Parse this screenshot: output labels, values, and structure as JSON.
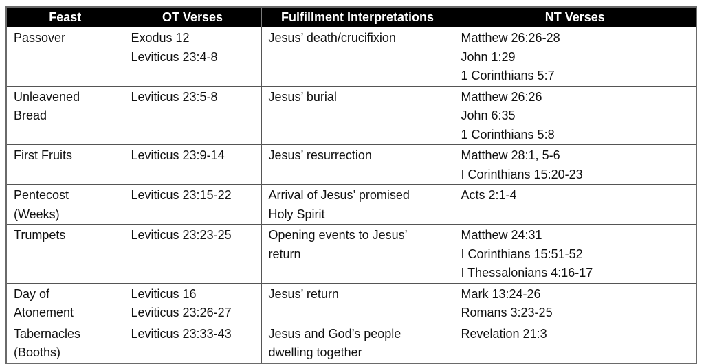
{
  "table": {
    "headers": [
      "Feast",
      "OT Verses",
      "Fulfillment Interpretations",
      "NT Verses"
    ],
    "rows": [
      {
        "feast": [
          "Passover"
        ],
        "ot": [
          "Exodus 12",
          "Leviticus 23:4-8"
        ],
        "fulfillment": [
          "Jesus’ death/crucifixion"
        ],
        "nt": [
          "Matthew 26:26-28",
          "John 1:29",
          "1 Corinthians 5:7"
        ]
      },
      {
        "feast": [
          "Unleavened",
          "Bread"
        ],
        "ot": [
          "Leviticus 23:5-8"
        ],
        "fulfillment": [
          "Jesus’ burial"
        ],
        "nt": [
          "Matthew 26:26",
          "John 6:35",
          "1 Corinthians 5:8"
        ]
      },
      {
        "feast": [
          "First Fruits"
        ],
        "ot": [
          "Leviticus 23:9-14"
        ],
        "fulfillment": [
          "Jesus’ resurrection"
        ],
        "nt": [
          "Matthew 28:1, 5-6",
          "I Corinthians 15:20-23"
        ]
      },
      {
        "feast": [
          "Pentecost",
          "(Weeks)"
        ],
        "ot": [
          "Leviticus 23:15-22"
        ],
        "fulfillment": [
          "Arrival of Jesus’ promised",
          "Holy Spirit"
        ],
        "nt": [
          "Acts 2:1-4"
        ]
      },
      {
        "feast": [
          "Trumpets"
        ],
        "ot": [
          "Leviticus 23:23-25"
        ],
        "fulfillment": [
          "Opening events to Jesus’",
          "return"
        ],
        "nt": [
          "Matthew 24:31",
          "I Corinthians 15:51-52",
          "I Thessalonians 4:16-17"
        ]
      },
      {
        "feast": [
          "Day of",
          "Atonement"
        ],
        "ot": [
          "Leviticus 16",
          "Leviticus 23:26-27"
        ],
        "fulfillment": [
          "Jesus’ return"
        ],
        "nt": [
          "Mark 13:24-26",
          "Romans 3:23-25"
        ]
      },
      {
        "feast": [
          "Tabernacles",
          "(Booths)"
        ],
        "ot": [
          "Leviticus 23:33-43"
        ],
        "fulfillment": [
          "Jesus and God’s people",
          "dwelling together"
        ],
        "nt": [
          "Revelation 21:3"
        ]
      }
    ]
  },
  "colors": {
    "header_background": "#000000",
    "header_text": "#ffffff",
    "body_text": "#111111",
    "border": "#555555"
  }
}
